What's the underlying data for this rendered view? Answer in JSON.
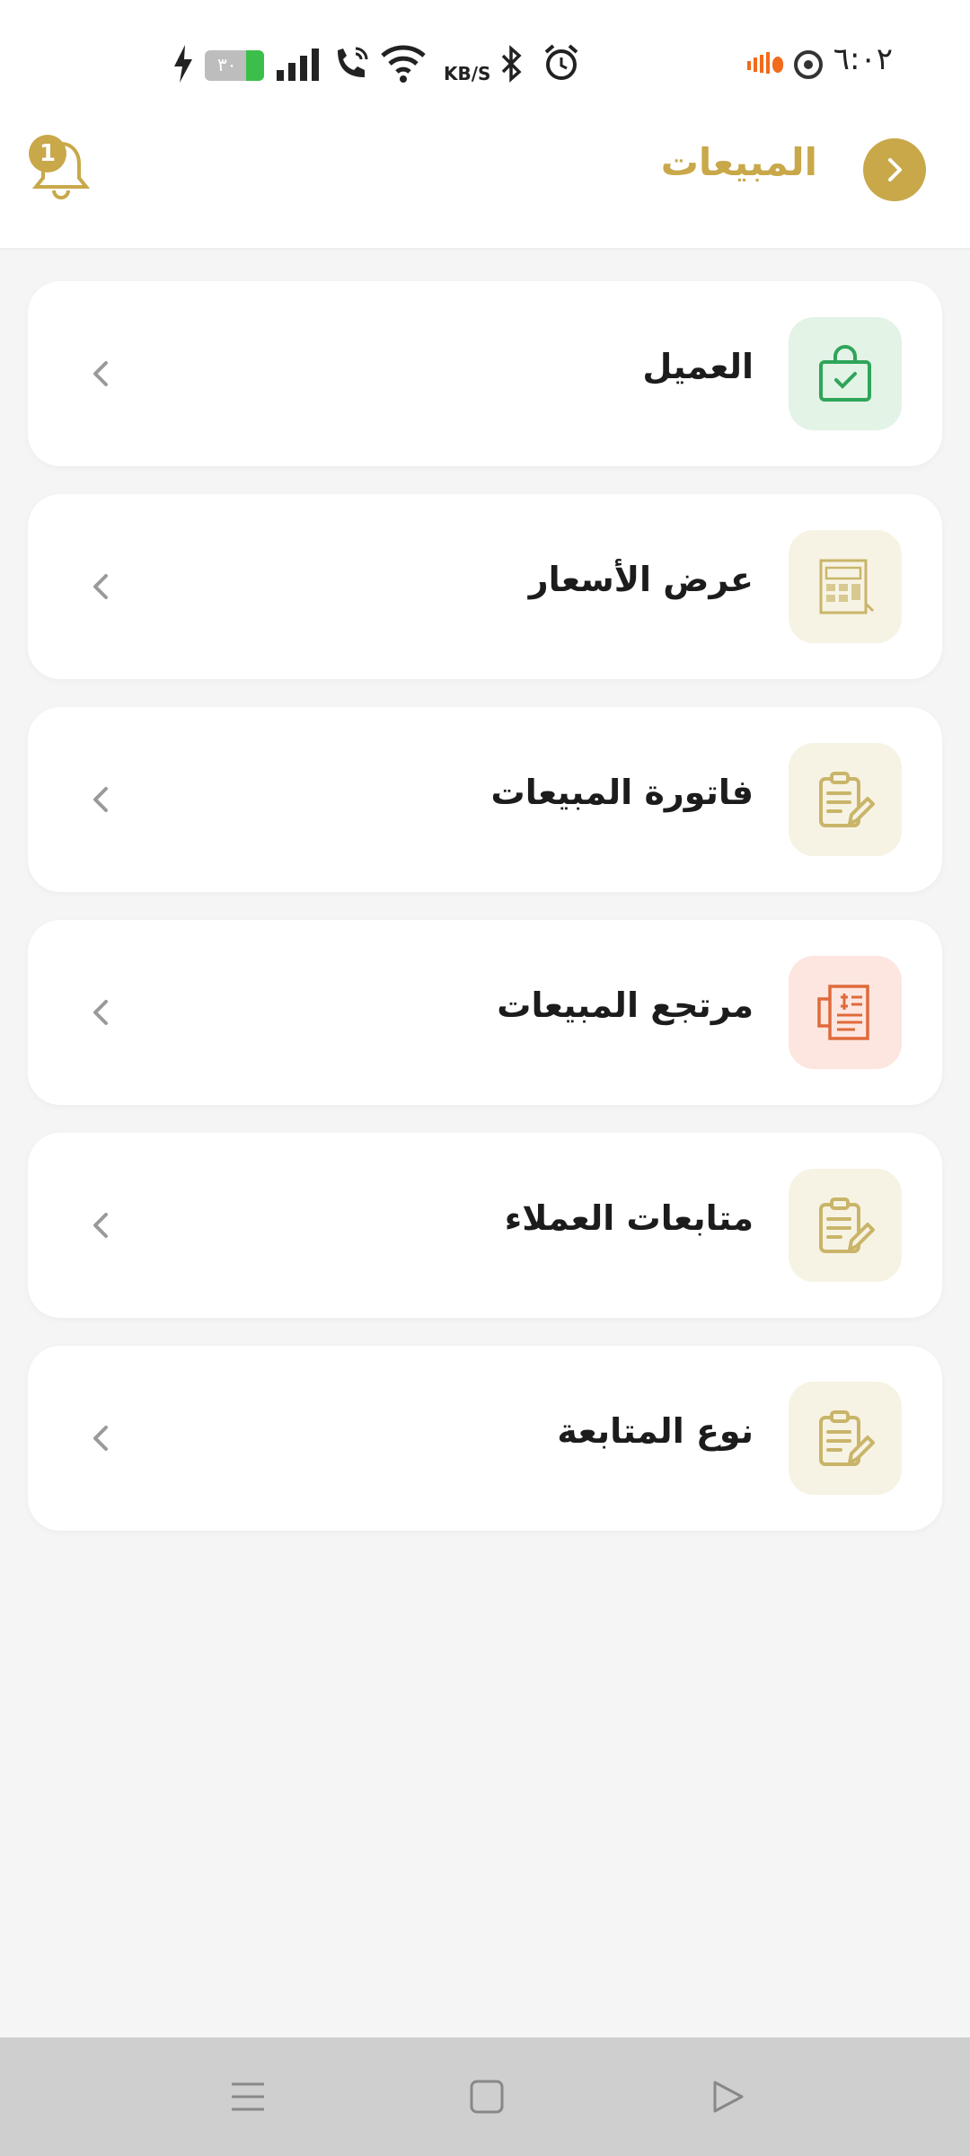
{
  "status_bar": {
    "time": "٦:٠٢",
    "battery": "٣٠",
    "net_speed_unit": "KB/S"
  },
  "header": {
    "title": "المبيعات",
    "notification_count": "1"
  },
  "menu": {
    "items": [
      {
        "label": "العميل",
        "icon": "shopping-bag-check-icon",
        "tile_color": "#e3f3e6",
        "icon_color": "#2fa55a"
      },
      {
        "label": "عرض الأسعار",
        "icon": "price-quote-icon",
        "tile_color": "#f7f3e4",
        "icon_color": "#c9b56a"
      },
      {
        "label": "فاتورة المبيعات",
        "icon": "clipboard-edit-icon",
        "tile_color": "#f7f3e4",
        "icon_color": "#c9b56a"
      },
      {
        "label": "مرتجع المبيعات",
        "icon": "receipt-return-icon",
        "tile_color": "#fde6e0",
        "icon_color": "#e06a3a"
      },
      {
        "label": "متابعات العملاء",
        "icon": "clipboard-edit-icon",
        "tile_color": "#f7f3e4",
        "icon_color": "#c9b56a"
      },
      {
        "label": "نوع المتابعة",
        "icon": "clipboard-edit-icon",
        "tile_color": "#f7f3e4",
        "icon_color": "#c9b56a"
      }
    ]
  },
  "colors": {
    "accent": "#c9a84a",
    "background": "#f5f5f5",
    "card": "#ffffff"
  }
}
